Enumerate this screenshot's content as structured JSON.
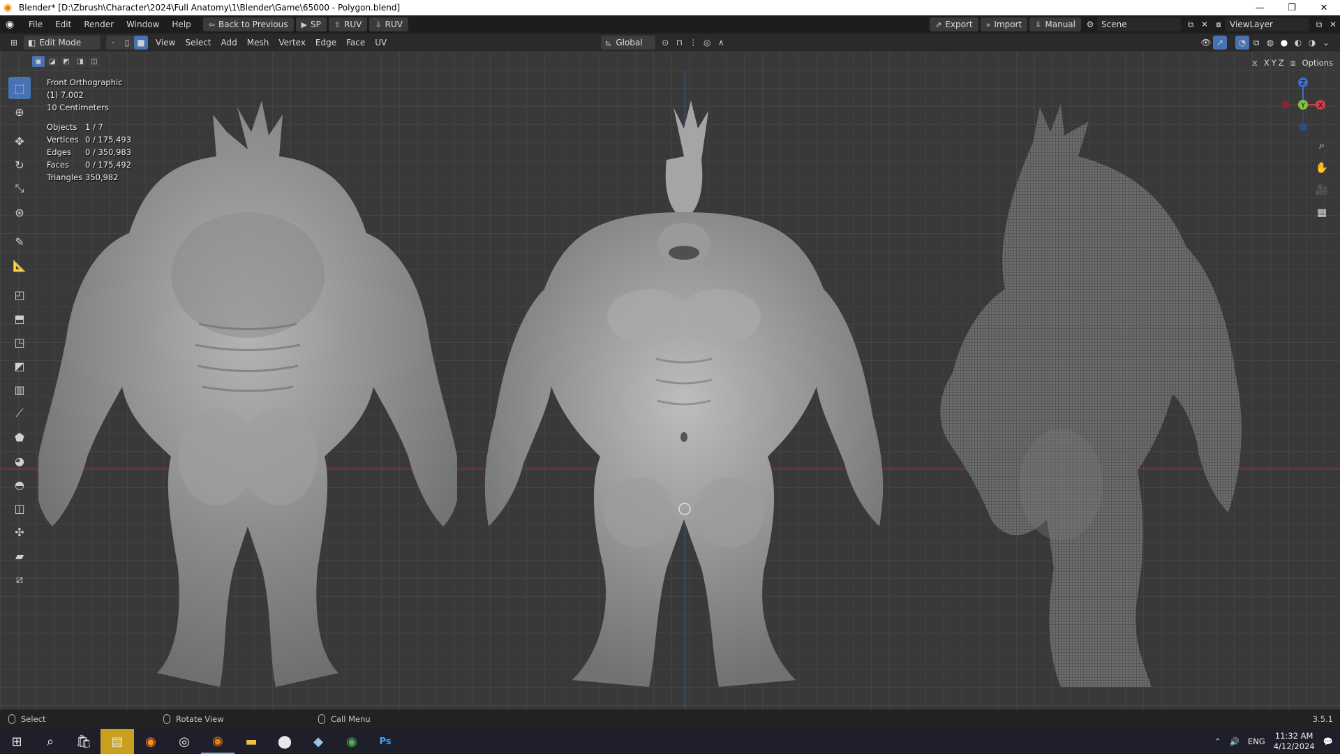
{
  "window": {
    "title": "Blender* [D:\\Zbrush\\Character\\2024\\Full Anatomy\\1\\Blender\\Game\\65000 - Polygon.blend]"
  },
  "menu": {
    "items": [
      "File",
      "Edit",
      "Render",
      "Window",
      "Help"
    ]
  },
  "quick_buttons": {
    "back": "Back to Previous",
    "sp": "SP",
    "ruv1": "RUV",
    "ruv2": "RUV"
  },
  "top_right": {
    "export": "Export",
    "import": "Import",
    "manual": "Manual",
    "scene": "Scene",
    "viewlayer": "ViewLayer"
  },
  "header": {
    "mode": "Edit Mode",
    "items": [
      "View",
      "Select",
      "Add",
      "Mesh",
      "Vertex",
      "Edge",
      "Face",
      "UV"
    ],
    "orientation": "Global",
    "options": "Options",
    "axes": [
      "X",
      "Y",
      "Z"
    ]
  },
  "viewport_info": {
    "view": "Front Orthographic",
    "frame": "(1) 7.002",
    "scale": "10 Centimeters"
  },
  "stats": [
    {
      "k": "Objects",
      "v": "1 / 7"
    },
    {
      "k": "Vertices",
      "v": "0 / 175,493"
    },
    {
      "k": "Edges",
      "v": "0 / 350,983"
    },
    {
      "k": "Faces",
      "v": "0 / 175,492"
    },
    {
      "k": "Triangles",
      "v": "350,982"
    }
  ],
  "gizmo": {
    "z": "Z",
    "y": "Y",
    "x": "X"
  },
  "status": {
    "select": "Select",
    "rotate": "Rotate View",
    "menu": "Call Menu",
    "version": "3.5.1"
  },
  "taskbar": {
    "lang": "ENG",
    "time": "11:32 AM",
    "date": "4/12/2024"
  },
  "colors": {
    "accent": "#4772b3",
    "x_axis": "#a8333b",
    "z_axis": "#2f6ec8",
    "mesh": "#9a9a9a"
  }
}
